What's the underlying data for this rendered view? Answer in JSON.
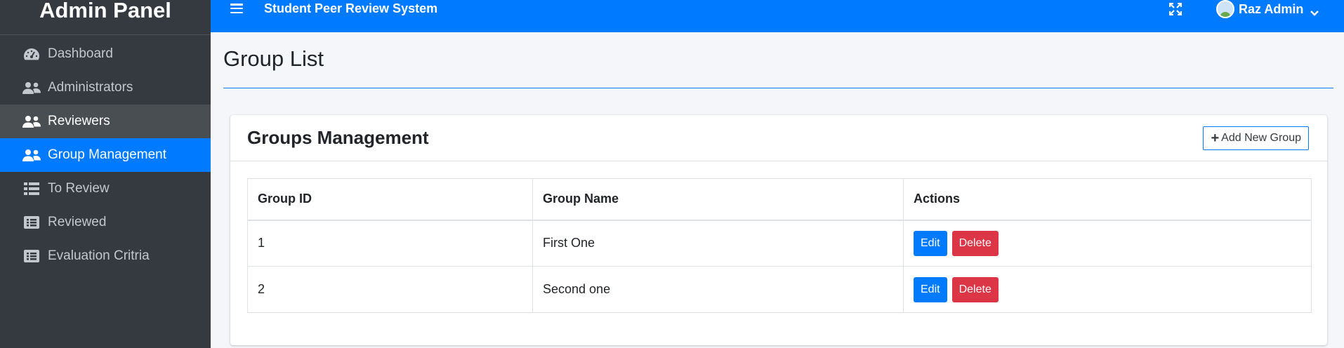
{
  "sidebar": {
    "brand": "Admin Panel",
    "items": [
      {
        "label": "Dashboard",
        "icon": "tachometer-icon"
      },
      {
        "label": "Administrators",
        "icon": "users-icon"
      },
      {
        "label": "Reviewers",
        "icon": "users-icon"
      },
      {
        "label": "Group Management",
        "icon": "users-icon"
      },
      {
        "label": "To Review",
        "icon": "list-icon"
      },
      {
        "label": "Reviewed",
        "icon": "list-alt-icon"
      },
      {
        "label": "Evaluation Critria",
        "icon": "list-alt-icon"
      }
    ],
    "active_item": "Group Management",
    "hover_item": "Reviewers"
  },
  "topbar": {
    "title": "Student Peer Review System",
    "user_name": "Raz Admin"
  },
  "page": {
    "title": "Group List"
  },
  "card": {
    "title": "Groups Management",
    "add_button": "Add New Group"
  },
  "table": {
    "headers": [
      "Group ID",
      "Group Name",
      "Actions"
    ],
    "rows": [
      {
        "id": "1",
        "name": "First One"
      },
      {
        "id": "2",
        "name": "Second one"
      }
    ],
    "edit_label": "Edit",
    "delete_label": "Delete"
  },
  "colors": {
    "primary": "#007bff",
    "danger": "#dc3545",
    "sidebar_bg": "#343a40"
  }
}
